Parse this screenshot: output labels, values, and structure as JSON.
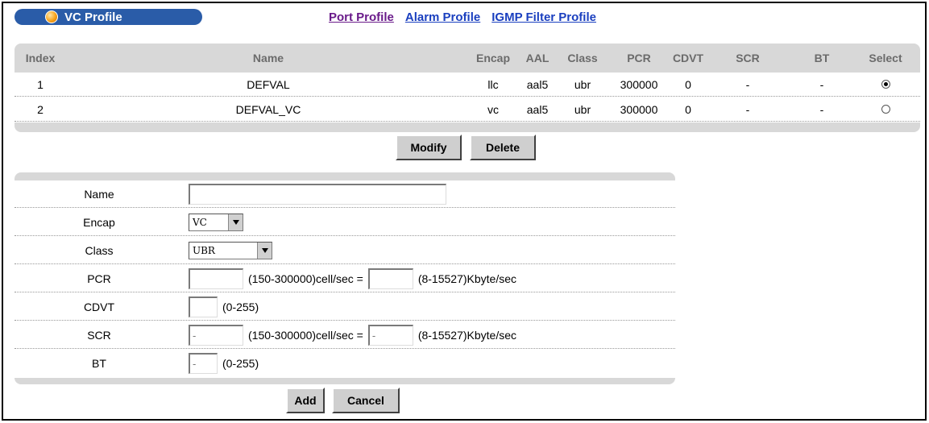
{
  "header": {
    "title": "VC Profile",
    "nav": [
      "Port Profile",
      "Alarm Profile",
      "IGMP Filter Profile"
    ]
  },
  "table": {
    "columns": [
      "Index",
      "Name",
      "Encap",
      "AAL",
      "Class",
      "PCR",
      "CDVT",
      "SCR",
      "BT",
      "Select"
    ],
    "rows": [
      {
        "index": "1",
        "name": "DEFVAL",
        "encap": "llc",
        "aal": "aal5",
        "class": "ubr",
        "pcr": "300000",
        "cdvt": "0",
        "scr": "-",
        "bt": "-",
        "selected": true
      },
      {
        "index": "2",
        "name": "DEFVAL_VC",
        "encap": "vc",
        "aal": "aal5",
        "class": "ubr",
        "pcr": "300000",
        "cdvt": "0",
        "scr": "-",
        "bt": "-",
        "selected": false
      }
    ]
  },
  "actions": {
    "modify": "Modify",
    "delete": "Delete"
  },
  "form": {
    "name_label": "Name",
    "name_value": "",
    "encap_label": "Encap",
    "encap_value": "VC",
    "class_label": "Class",
    "class_value": "UBR",
    "pcr_label": "PCR",
    "pcr_cell_value": "",
    "pcr_cell_hint": "(150-300000)cell/sec =",
    "pcr_kbyte_value": "",
    "pcr_kbyte_hint": "(8-15527)Kbyte/sec",
    "cdvt_label": "CDVT",
    "cdvt_value": "",
    "cdvt_hint": "(0-255)",
    "scr_label": "SCR",
    "scr_cell_value": "-",
    "scr_cell_hint": "(150-300000)cell/sec =",
    "scr_kbyte_value": "-",
    "scr_kbyte_hint": "(8-15527)Kbyte/sec",
    "bt_label": "BT",
    "bt_value": "-",
    "bt_hint": "(0-255)"
  },
  "buttons": {
    "add": "Add",
    "cancel": "Cancel"
  },
  "colors": {
    "title_bar": "#2a5ca8",
    "panel_bg": "#d8d8d8",
    "link_visited": "#6a1b8a",
    "link": "#1a3fbf"
  }
}
